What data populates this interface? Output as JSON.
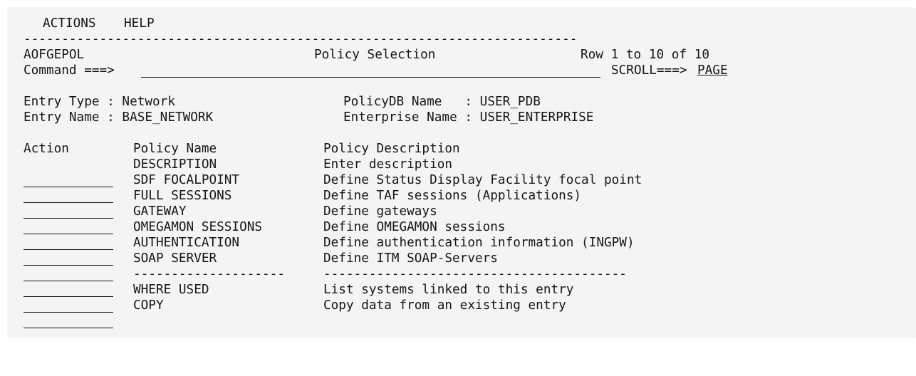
{
  "menu": {
    "actions": "ACTIONS",
    "help": "HELP"
  },
  "separator": "-------------------------------------------------------------------------",
  "header": {
    "panel_id": "AOFGEPOL",
    "title": "Policy Selection",
    "row_info": "Row 1 to 10 of 10",
    "command_label": "Command ===>",
    "command_value": "",
    "scroll_label": "SCROLL===>",
    "scroll_value": "PAGE"
  },
  "entry": {
    "type_label": "Entry Type : Network",
    "name_label": "Entry Name : BASE_NETWORK",
    "policydb_label": "PolicyDB Name   : USER_PDB",
    "enterprise_label": "Enterprise Name : USER_ENTERPRISE"
  },
  "table": {
    "headers": {
      "action": "Action",
      "policy_name": "Policy Name",
      "policy_description": "Policy Description"
    },
    "rows": [
      {
        "name": "DESCRIPTION",
        "description": "Enter description"
      },
      {
        "name": "SDF FOCALPOINT",
        "description": "Define Status Display Facility focal point"
      },
      {
        "name": "FULL SESSIONS",
        "description": "Define TAF sessions (Applications)"
      },
      {
        "name": "GATEWAY",
        "description": "Define gateways"
      },
      {
        "name": "OMEGAMON SESSIONS",
        "description": "Define OMEGAMON sessions"
      },
      {
        "name": "AUTHENTICATION",
        "description": "Define authentication information (INGPW)"
      },
      {
        "name": "SOAP SERVER",
        "description": "Define ITM SOAP-Servers"
      },
      {
        "name": "--------------------",
        "description": "----------------------------------------"
      },
      {
        "name": "WHERE USED",
        "description": "List systems linked to this entry"
      },
      {
        "name": "COPY",
        "description": "Copy data from an existing entry"
      }
    ]
  }
}
